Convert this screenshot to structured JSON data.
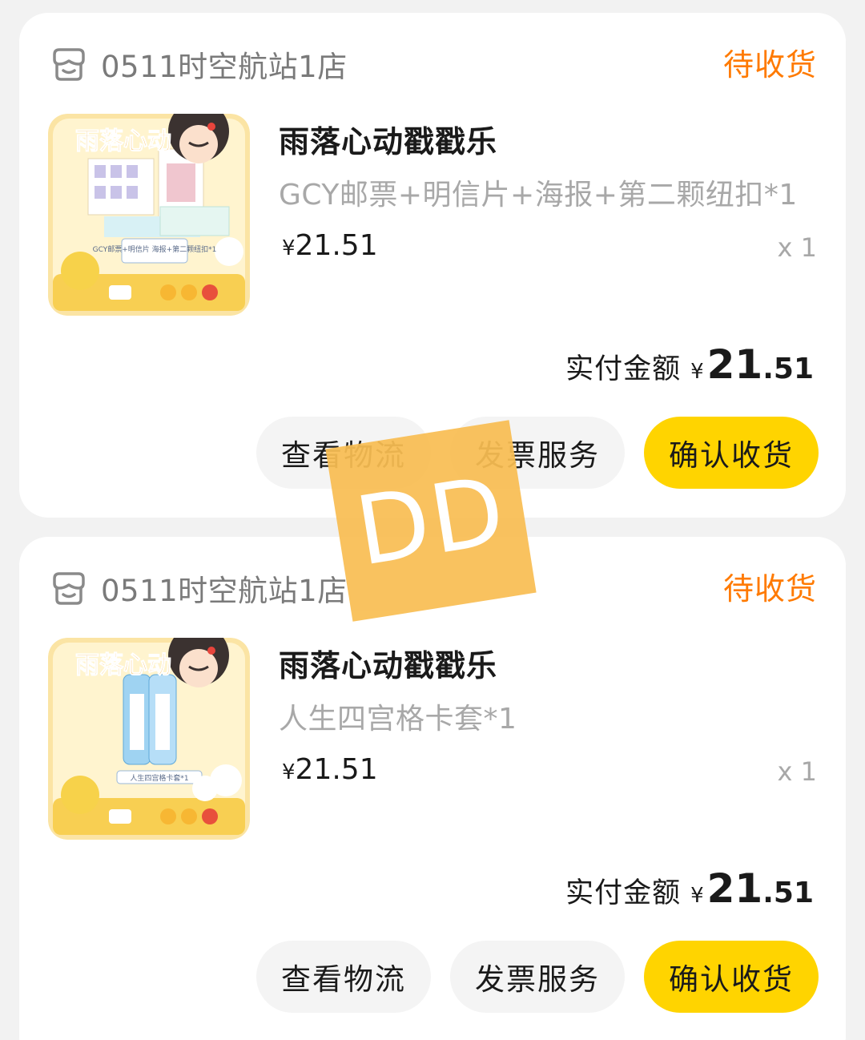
{
  "orders": [
    {
      "store_name": "0511时空航站1店",
      "status": "待收货",
      "product_title": "雨落心动戳戳乐",
      "product_spec": "GCY邮票+明信片+海报+第二颗纽扣*1",
      "currency": "¥",
      "price": "21.51",
      "quantity": "x 1",
      "paid_label": "实付金额",
      "paid_int": "21",
      "paid_dec": ".51",
      "thumb_caption": "GCY邮票+明信片 海报+第二颗纽扣*1",
      "thumb_logo": "雨落心动",
      "buttons": {
        "logistics": "查看物流",
        "invoice": "发票服务",
        "confirm": "确认收货"
      }
    },
    {
      "store_name": "0511时空航站1店",
      "status": "待收货",
      "product_title": "雨落心动戳戳乐",
      "product_spec": "人生四宫格卡套*1",
      "currency": "¥",
      "price": "21.51",
      "quantity": "x 1",
      "paid_label": "实付金额",
      "paid_int": "21",
      "paid_dec": ".51",
      "thumb_caption": "人生四宫格卡套*1",
      "thumb_logo": "雨落心动",
      "buttons": {
        "logistics": "查看物流",
        "invoice": "发票服务",
        "confirm": "确认收货"
      }
    }
  ],
  "overlay_badge": "DD",
  "colors": {
    "status_orange": "#ff7a00",
    "confirm_yellow": "#ffd400",
    "badge_orange": "#f9be53",
    "card_bg": "#ffffff",
    "page_bg": "#f2f2f2"
  },
  "icons": [
    "store-icon"
  ]
}
